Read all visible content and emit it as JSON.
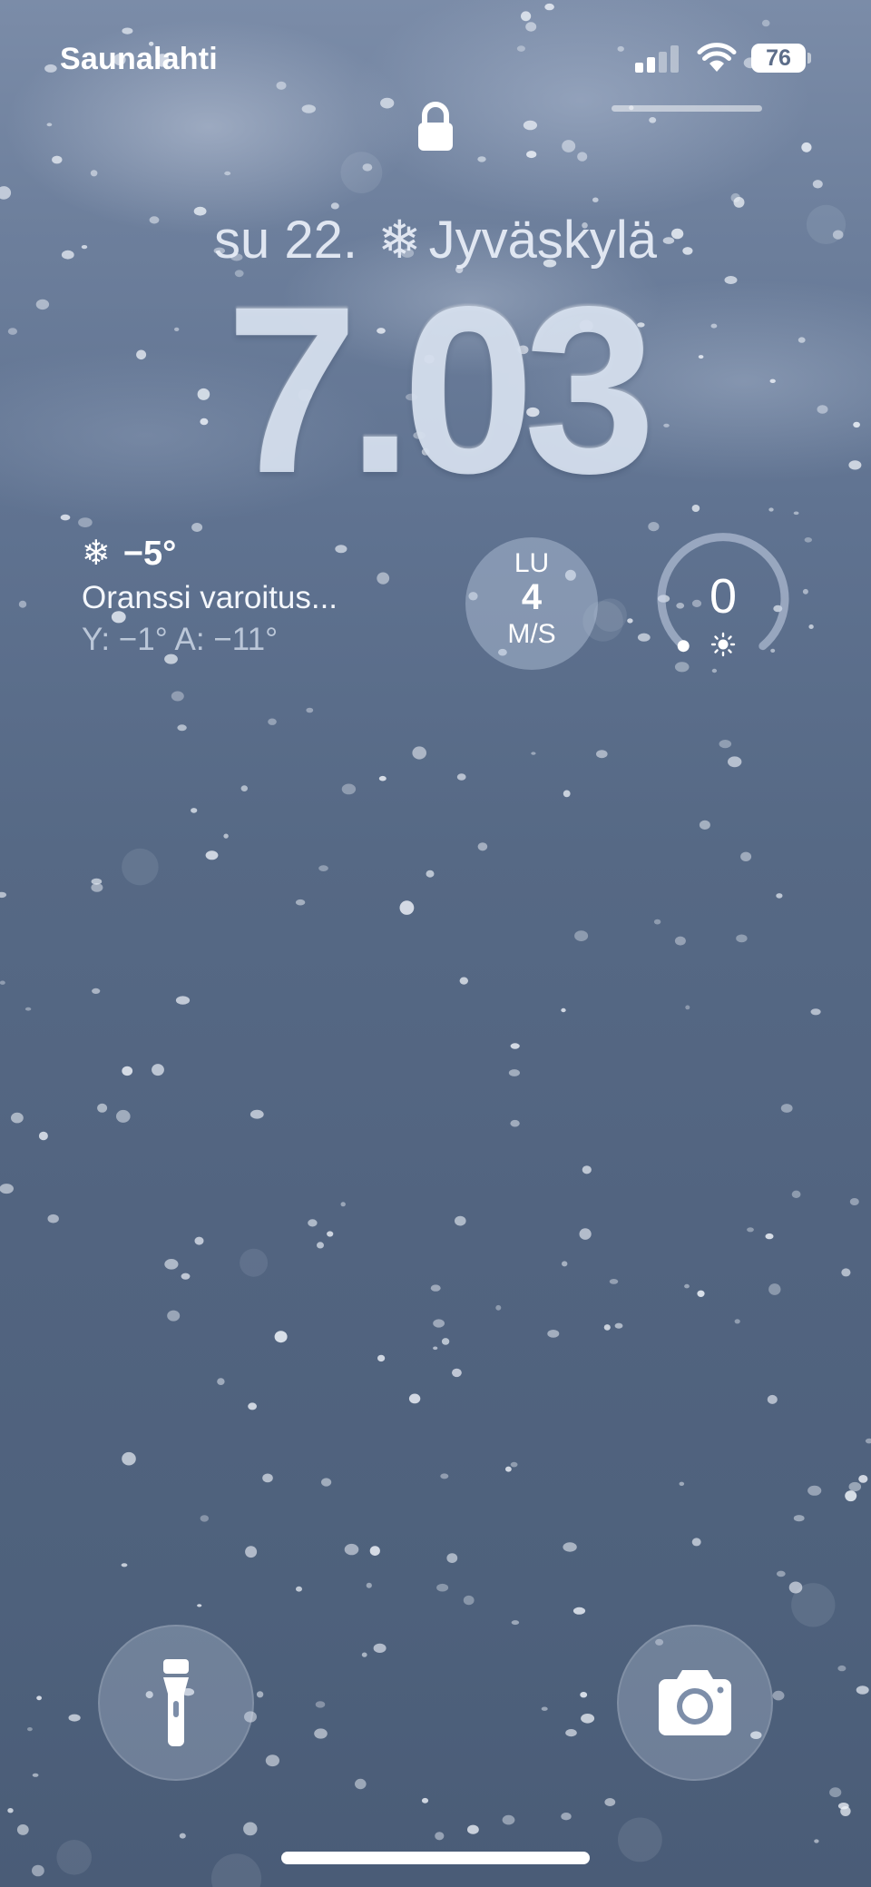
{
  "status_bar": {
    "carrier": "Saunalahti",
    "signal_bars_filled": 2,
    "signal_bars_total": 4,
    "battery_percent": "76"
  },
  "lock_screen": {
    "date": "su 22.",
    "location": "Jyväskylä",
    "weather_symbol": "❄",
    "time": "7.03"
  },
  "weather_widget": {
    "icon": "snowflake-icon",
    "temperature": "−5°",
    "warning": "Oranssi varoitus...",
    "high_low": "Y: −1° A: −11°"
  },
  "wind_widget": {
    "direction": "LU",
    "speed": "4",
    "unit": "M/S"
  },
  "uv_widget": {
    "value": "0",
    "level_fraction": 0
  },
  "buttons": {
    "flashlight": "flashlight-icon",
    "camera": "camera-icon"
  },
  "colors": {
    "background_top": "#7b8ca8",
    "background_bottom": "#4a5c77",
    "text": "#ffffff"
  }
}
